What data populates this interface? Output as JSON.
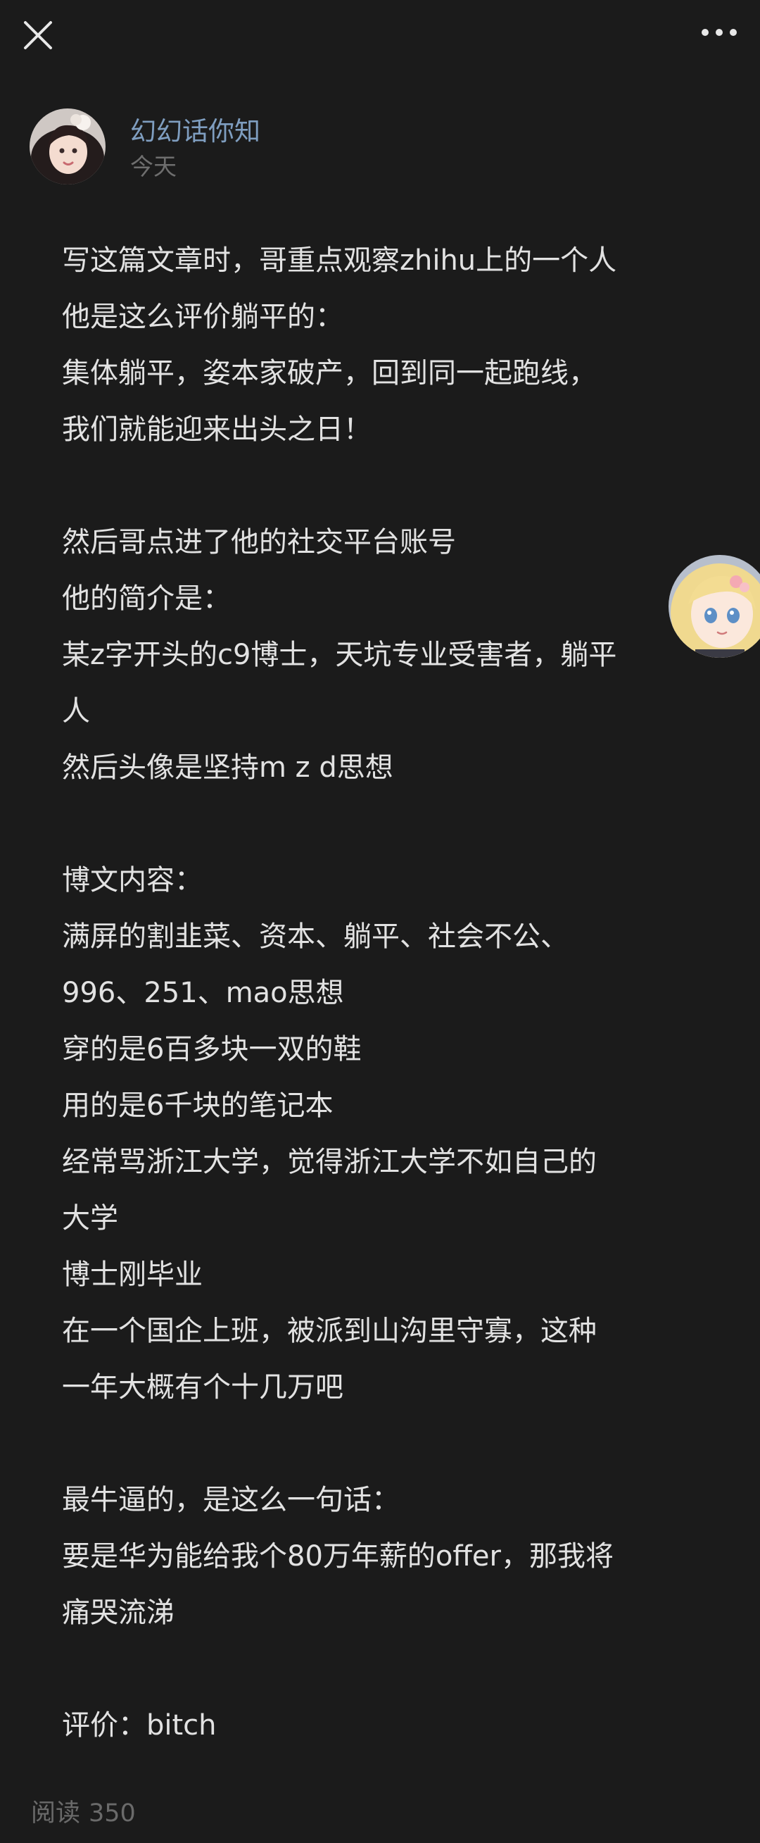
{
  "header": {
    "close_icon": "close-icon",
    "more_icon": "more-options-icon"
  },
  "author": {
    "name": "幻幻话你知",
    "time": "今天"
  },
  "article": {
    "lines": [
      "写这篇文章时，哥重点观察zhihu上的一个人",
      "他是这么评价躺平的：",
      "集体躺平，姿本家破产，回到同一起跑线，",
      "我们就能迎来出头之日！",
      "",
      "然后哥点进了他的社交平台账号",
      "他的简介是：",
      "某z字开头的c9博士，天坑专业受害者，躺平",
      "人",
      "然后头像是坚持m z d思想",
      "",
      "博文内容：",
      "满屏的割韭菜、资本、躺平、社会不公、",
      "996、251、mao思想",
      "穿的是6百多块一双的鞋",
      "用的是6千块的笔记本",
      "经常骂浙江大学，觉得浙江大学不如自己的",
      "大学",
      "博士刚毕业",
      "在一个国企上班，被派到山沟里守寡，这种",
      "一年大概有个十几万吧",
      "",
      "最牛逼的，是这么一句话：",
      "要是华为能给我个80万年薪的offer，那我将",
      "痛哭流涕",
      "",
      "评价：bitch"
    ]
  },
  "footer": {
    "read_label": "阅读",
    "read_count": "350"
  },
  "colors": {
    "background": "#1b1b1b",
    "text": "#e2e2e2",
    "author_name": "#7f9ec0",
    "muted": "#6e6e6e"
  }
}
